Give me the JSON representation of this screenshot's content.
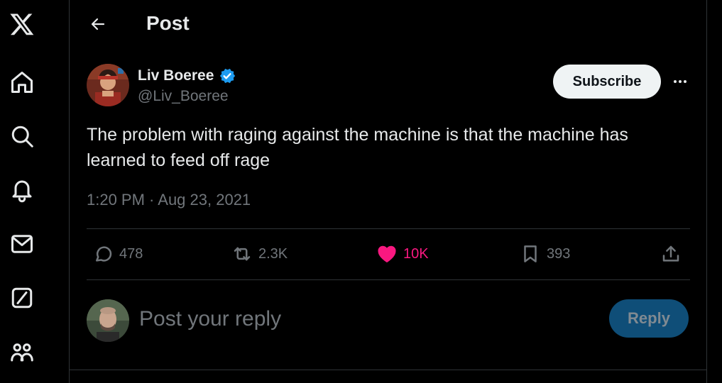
{
  "nav": {
    "items": [
      {
        "icon": "x-logo-icon"
      },
      {
        "icon": "home-icon"
      },
      {
        "icon": "search-icon"
      },
      {
        "icon": "notifications-bell-icon"
      },
      {
        "icon": "messages-envelope-icon"
      },
      {
        "icon": "grok-icon"
      },
      {
        "icon": "communities-icon"
      }
    ]
  },
  "header": {
    "title": "Post"
  },
  "post": {
    "author_name": "Liv Boeree",
    "author_handle": "@Liv_Boeree",
    "verified": true,
    "text": "The problem with raging against the machine is that the machine has learned to feed off rage",
    "timestamp": "1:20 PM · Aug 23, 2021",
    "subscribe_label": "Subscribe"
  },
  "actions": {
    "replies": "478",
    "reposts": "2.3K",
    "likes": "10K",
    "bookmarks": "393"
  },
  "reply": {
    "placeholder": "Post your reply",
    "button_label": "Reply"
  },
  "colors": {
    "background": "#000000",
    "text": "#e7e9ea",
    "muted": "#71767b",
    "like": "#f91880",
    "verified": "#1d9bf0",
    "reply_button": "#0f4e78"
  }
}
